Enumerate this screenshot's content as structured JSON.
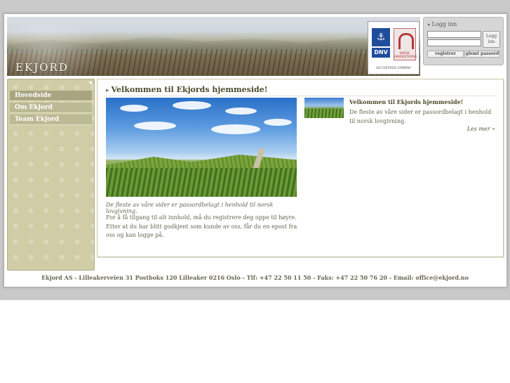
{
  "brand": {
    "logo_text": "EKJORD"
  },
  "certification": {
    "dnv_label": "DNV",
    "accreditation_text": "NORSK AKKREDITERING",
    "footer_text": "ISO CERTIFIED COMPANY"
  },
  "login": {
    "title": "Logg inn",
    "username_value": "",
    "password_value": "",
    "login_button": "Logg inn",
    "register_button": "registrer",
    "forgot_button": "glemt passord"
  },
  "sidebar": {
    "items": [
      {
        "label": "Hovedside",
        "active": true
      },
      {
        "label": "Om Ekjord",
        "active": false
      },
      {
        "label": "Team Ekjord",
        "active": false
      }
    ]
  },
  "main": {
    "title": "Velkommen til Ekjords hjemmeside!",
    "caption": "De fleste av våre sider er passordbelagt i henhold til norsk lovgivning.",
    "body": "For å få tilgang til alt innhold, må du registrere deg oppe til høyre. Etter at du har blitt godkjent som kunde av oss, får du en epost fra oss og kan logge på."
  },
  "news": {
    "title": "Velkommen til Ekjords hjemmeside!",
    "text": "De fleste av våre sider er passordbelagt i henhold til norsk lovgivning.",
    "more_link": "Les mer »"
  },
  "footer": {
    "text": "Ekjord AS - Lilleakerveien 31 Postboks 120 Lilleaker 0216 Oslo - Tlf: +47 22 50 11 50 - Faks: +47 22 50 76 20 - Email: office@ekjord.no"
  },
  "colors": {
    "sidebar_bg": "#cfcca6",
    "nav_active": "#a8a580",
    "text": "#666650",
    "heading": "#4b4b2c"
  }
}
